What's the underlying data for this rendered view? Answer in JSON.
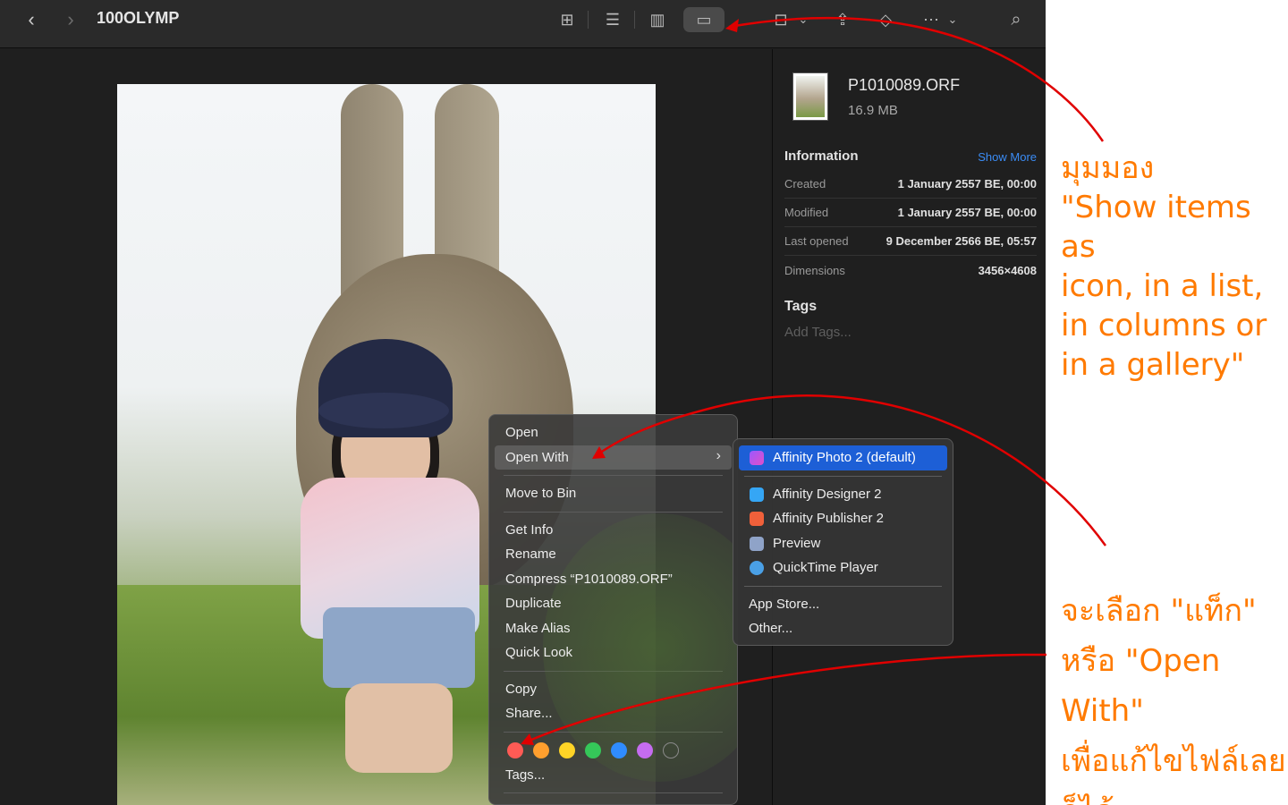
{
  "window": {
    "title": "100OLYMP",
    "toolbar": {
      "back_icon": "‹",
      "forward_icon": "›",
      "view_icon": "⊞",
      "list_icon": "☰",
      "columns_icon": "▥",
      "gallery_icon": "▭",
      "group_icon": "⊟",
      "share_icon": "⇪",
      "tag_icon": "◇",
      "more_icon": "⋯",
      "search_icon": "⌕",
      "chevron": "⌄"
    }
  },
  "inspector": {
    "file_name": "P1010089.ORF",
    "file_size": "16.9 MB",
    "information_heading": "Information",
    "show_more": "Show More",
    "rows": [
      {
        "key": "Created",
        "value": "1 January 2557 BE, 00:00"
      },
      {
        "key": "Modified",
        "value": "1 January 2557 BE, 00:00"
      },
      {
        "key": "Last opened",
        "value": "9 December 2566 BE, 05:57"
      },
      {
        "key": "Dimensions",
        "value": "3456×4608"
      }
    ],
    "tags_heading": "Tags",
    "add_tags": "Add Tags..."
  },
  "context_menu": {
    "open": "Open",
    "open_with": "Open With",
    "chevron": "›",
    "move_to_bin": "Move to Bin",
    "get_info": "Get Info",
    "rename": "Rename",
    "compress": "Compress “P1010089.ORF”",
    "duplicate": "Duplicate",
    "make_alias": "Make Alias",
    "quick_look": "Quick Look",
    "copy": "Copy",
    "share": "Share...",
    "tags": "Tags...",
    "tag_colors": [
      "#ff5b55",
      "#ff9f2e",
      "#ffd426",
      "#35c759",
      "#2f8cff",
      "#c56cf0",
      "none"
    ]
  },
  "submenu": {
    "default_app": "Affinity Photo 2 (default)",
    "apps": [
      {
        "label": "Affinity Designer 2",
        "color": "#35a6f5"
      },
      {
        "label": "Affinity Publisher 2",
        "color": "#f0603a"
      },
      {
        "label": "Preview",
        "color": "#8fa3c8"
      },
      {
        "label": "QuickTime Player",
        "color": "#4aa0e6"
      }
    ],
    "app_store": "App Store...",
    "other": "Other..."
  },
  "annotations": {
    "view_note": [
      "มุมมอง",
      "\"Show items as",
      "icon, in a list,",
      " in columns or",
      " in a gallery\""
    ],
    "tag_note": [
      "จะเลือก \"แท็ก\"",
      "หรือ \"Open With\"",
      "เพื่อแก้ไขไฟล์เลย",
      "ก็ได้"
    ]
  },
  "colors": {
    "annotation": "#ff7a00",
    "arrow": "#e00000",
    "selection": "#1d5fd6"
  }
}
